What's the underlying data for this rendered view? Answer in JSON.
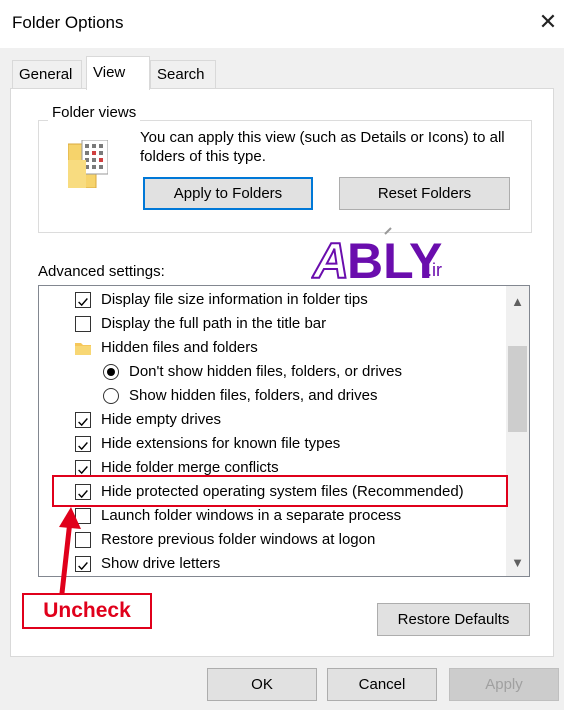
{
  "window": {
    "title": "Folder Options",
    "close_glyph": "✕"
  },
  "tabs": [
    {
      "label": "General",
      "active": false
    },
    {
      "label": "View",
      "active": true
    },
    {
      "label": "Search",
      "active": false
    }
  ],
  "folder_views": {
    "legend": "Folder views",
    "description": "You can apply this view (such as Details or Icons) to all folders of this type.",
    "apply_label": "Apply to Folders",
    "reset_label": "Reset Folders",
    "icon": "folder-view-icon"
  },
  "advanced": {
    "label": "Advanced settings:",
    "items": [
      {
        "label": "Display file size information in folder tips",
        "type": "checkbox",
        "checked": true,
        "indent": 0
      },
      {
        "label": "Display the full path in the title bar",
        "type": "checkbox",
        "checked": false,
        "indent": 0
      },
      {
        "label": "Hidden files and folders",
        "type": "folder",
        "checked": false,
        "indent": 0
      },
      {
        "label": "Don't show hidden files, folders, or drives",
        "type": "radio",
        "checked": true,
        "indent": 1
      },
      {
        "label": "Show hidden files, folders, and drives",
        "type": "radio",
        "checked": false,
        "indent": 1
      },
      {
        "label": "Hide empty drives",
        "type": "checkbox",
        "checked": true,
        "indent": 0
      },
      {
        "label": "Hide extensions for known file types",
        "type": "checkbox",
        "checked": true,
        "indent": 0
      },
      {
        "label": "Hide folder merge conflicts",
        "type": "checkbox",
        "checked": true,
        "indent": 0
      },
      {
        "label": "Hide protected operating system files (Recommended)",
        "type": "checkbox",
        "checked": true,
        "indent": 0
      },
      {
        "label": "Launch folder windows in a separate process",
        "type": "checkbox",
        "checked": false,
        "indent": 0
      },
      {
        "label": "Restore previous folder windows at logon",
        "type": "checkbox",
        "checked": false,
        "indent": 0
      },
      {
        "label": "Show drive letters",
        "type": "checkbox",
        "checked": true,
        "indent": 0
      }
    ],
    "scroll_up_glyph": "▲",
    "scroll_down_glyph": "▼"
  },
  "restore_defaults_label": "Restore Defaults",
  "annotation": {
    "callout_text": "Uncheck",
    "color": "#e0001b"
  },
  "watermark": {
    "brand": "ABLY",
    "suffix": ".ir",
    "color": "#6a0dad"
  },
  "footer": {
    "ok_label": "OK",
    "cancel_label": "Cancel",
    "apply_label": "Apply",
    "apply_disabled": true
  },
  "colors": {
    "accent": "#0078d7",
    "annotation": "#e0001b"
  }
}
